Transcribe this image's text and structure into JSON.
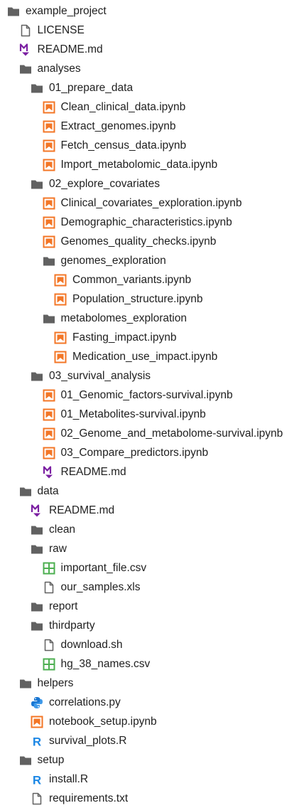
{
  "colors": {
    "folder": "#616161",
    "file": "#616161",
    "notebook": "#F37626",
    "markdown": "#7B1FA2",
    "csv": "#4CAF50",
    "python": "#1976D2",
    "r": "#1E88E5"
  },
  "tree": [
    {
      "label": "example_project",
      "type": "folder",
      "depth": 0
    },
    {
      "label": "LICENSE",
      "type": "file",
      "depth": 1
    },
    {
      "label": "README.md",
      "type": "markdown",
      "depth": 1
    },
    {
      "label": "analyses",
      "type": "folder",
      "depth": 1
    },
    {
      "label": "01_prepare_data",
      "type": "folder",
      "depth": 2
    },
    {
      "label": "Clean_clinical_data.ipynb",
      "type": "notebook",
      "depth": 3
    },
    {
      "label": "Extract_genomes.ipynb",
      "type": "notebook",
      "depth": 3
    },
    {
      "label": "Fetch_census_data.ipynb",
      "type": "notebook",
      "depth": 3
    },
    {
      "label": "Import_metabolomic_data.ipynb",
      "type": "notebook",
      "depth": 3
    },
    {
      "label": "02_explore_covariates",
      "type": "folder",
      "depth": 2
    },
    {
      "label": "Clinical_covariates_exploration.ipynb",
      "type": "notebook",
      "depth": 3
    },
    {
      "label": "Demographic_characteristics.ipynb",
      "type": "notebook",
      "depth": 3
    },
    {
      "label": "Genomes_quality_checks.ipynb",
      "type": "notebook",
      "depth": 3
    },
    {
      "label": "genomes_exploration",
      "type": "folder",
      "depth": 3
    },
    {
      "label": "Common_variants.ipynb",
      "type": "notebook",
      "depth": 4
    },
    {
      "label": "Population_structure.ipynb",
      "type": "notebook",
      "depth": 4
    },
    {
      "label": "metabolomes_exploration",
      "type": "folder",
      "depth": 3
    },
    {
      "label": "Fasting_impact.ipynb",
      "type": "notebook",
      "depth": 4
    },
    {
      "label": "Medication_use_impact.ipynb",
      "type": "notebook",
      "depth": 4
    },
    {
      "label": "03_survival_analysis",
      "type": "folder",
      "depth": 2
    },
    {
      "label": "01_Genomic_factors-survival.ipynb",
      "type": "notebook",
      "depth": 3
    },
    {
      "label": "01_Metabolites-survival.ipynb",
      "type": "notebook",
      "depth": 3
    },
    {
      "label": "02_Genome_and_metabolome-survival.ipynb",
      "type": "notebook",
      "depth": 3
    },
    {
      "label": "03_Compare_predictors.ipynb",
      "type": "notebook",
      "depth": 3
    },
    {
      "label": "README.md",
      "type": "markdown",
      "depth": 3
    },
    {
      "label": "data",
      "type": "folder",
      "depth": 1
    },
    {
      "label": "README.md",
      "type": "markdown",
      "depth": 2
    },
    {
      "label": "clean",
      "type": "folder",
      "depth": 2
    },
    {
      "label": "raw",
      "type": "folder",
      "depth": 2
    },
    {
      "label": "important_file.csv",
      "type": "csv",
      "depth": 3
    },
    {
      "label": "our_samples.xls",
      "type": "file",
      "depth": 3
    },
    {
      "label": "report",
      "type": "folder",
      "depth": 2
    },
    {
      "label": "thirdparty",
      "type": "folder",
      "depth": 2
    },
    {
      "label": "download.sh",
      "type": "file",
      "depth": 3
    },
    {
      "label": "hg_38_names.csv",
      "type": "csv",
      "depth": 3
    },
    {
      "label": "helpers",
      "type": "folder",
      "depth": 1
    },
    {
      "label": "correlations.py",
      "type": "python",
      "depth": 2
    },
    {
      "label": "notebook_setup.ipynb",
      "type": "notebook",
      "depth": 2
    },
    {
      "label": "survival_plots.R",
      "type": "r",
      "depth": 2
    },
    {
      "label": "setup",
      "type": "folder",
      "depth": 1
    },
    {
      "label": "install.R",
      "type": "r",
      "depth": 2
    },
    {
      "label": "requirements.txt",
      "type": "file",
      "depth": 2
    }
  ]
}
